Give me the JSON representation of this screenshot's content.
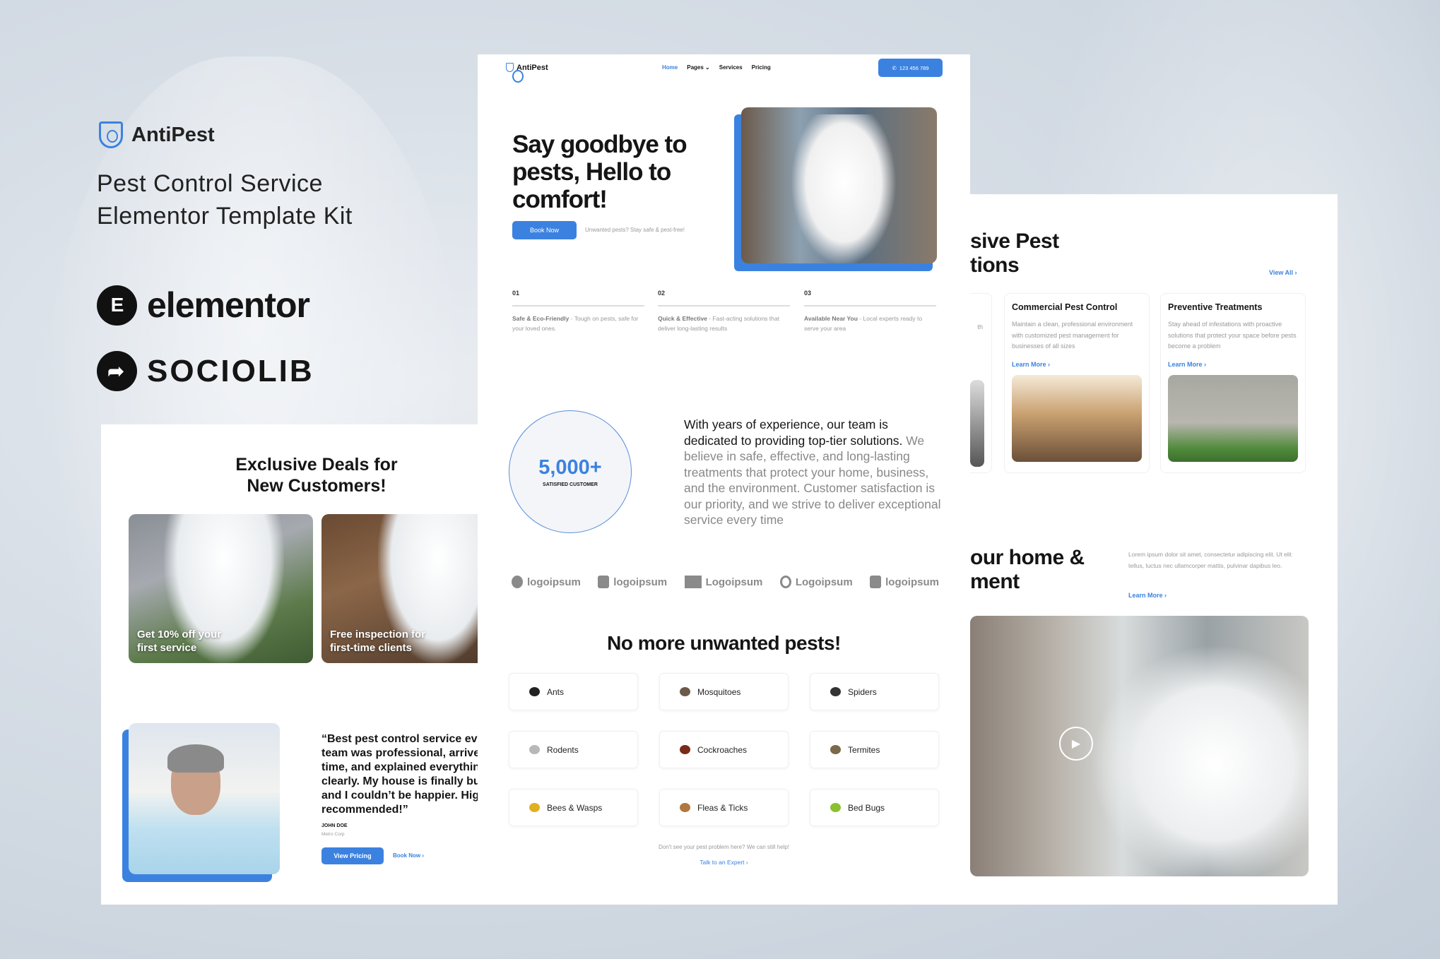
{
  "brand": {
    "name": "AntiPest",
    "title_line1": "Pest Control Service",
    "title_line2": "Elementor Template Kit",
    "partner1": "elementor",
    "partner2": "SOCIOLIB",
    "partner1_icon": "elementor-logo-icon",
    "partner2_icon": "share-arrow-icon"
  },
  "colors": {
    "accent": "#3b82e0",
    "text": "#151515",
    "muted": "#999999"
  },
  "site": {
    "logo": "AntiPest",
    "nav": [
      {
        "label": "Home",
        "active": true
      },
      {
        "label": "Pages",
        "dropdown": true
      },
      {
        "label": "Services"
      },
      {
        "label": "Pricing"
      }
    ],
    "phone": "123 456 789",
    "hero": {
      "line1": "Say goodbye to",
      "line2": "pests, Hello to",
      "line3": "comfort!",
      "cta": "Book Now",
      "sub": "Unwanted pests? Stay safe & pest-free!"
    },
    "features": [
      {
        "num": "01",
        "title": "Safe & Eco-Friendly",
        "desc": " - Tough on pests, safe for your loved ones."
      },
      {
        "num": "02",
        "title": "Quick & Effective",
        "desc": " - Fast-acting solutions that deliver long-lasting results"
      },
      {
        "num": "03",
        "title": "Available Near You",
        "desc": " - Local experts ready to serve your area"
      }
    ],
    "stat": {
      "value": "5,000+",
      "label": "SATISFIED CUSTOMER"
    },
    "about": {
      "lead": "With years of experience, our team is dedicated to providing top-tier solutions.",
      "body": " We believe in safe, effective, and long-lasting treatments that protect your home, business, and the environment. Customer satisfaction is our priority, and we strive to deliver exceptional service every time"
    },
    "logos": [
      "logoipsum",
      "logoipsum",
      "Logoipsum",
      "Logoipsum",
      "logoipsum"
    ],
    "pests_title": "No more unwanted pests!",
    "pests": [
      {
        "label": "Ants",
        "icon": "ant-icon",
        "color": "#222"
      },
      {
        "label": "Mosquitoes",
        "icon": "mosquito-icon",
        "color": "#6b5a4a"
      },
      {
        "label": "Spiders",
        "icon": "spider-icon",
        "color": "#333"
      },
      {
        "label": "Rodents",
        "icon": "mouse-icon",
        "color": "#b8b8b8"
      },
      {
        "label": "Cockroaches",
        "icon": "cockroach-icon",
        "color": "#7a2a1a"
      },
      {
        "label": "Termites",
        "icon": "termite-icon",
        "color": "#7a6a4a"
      },
      {
        "label": "Bees & Wasps",
        "icon": "bee-icon",
        "color": "#e0b020"
      },
      {
        "label": "Fleas & Ticks",
        "icon": "fly-icon",
        "color": "#b07840"
      },
      {
        "label": "Bed Bugs",
        "icon": "bug-icon",
        "color": "#8ac030"
      }
    ],
    "pests_note": "Don't see your pest problem here? We can still help!",
    "pests_link": "Talk to an Expert"
  },
  "deals": {
    "title_line1": "Exclusive Deals for",
    "title_line2": "New Customers!",
    "items": [
      "Get 10% off your first service",
      "Free inspection for first-time clients"
    ]
  },
  "testimonial": {
    "quote_lines": [
      "“Best pest control service ever!",
      "team was professional, arrived o",
      "time, and explained everything",
      "clearly. My house is finally bug-f",
      "and I couldn’t be happier. Highly",
      "recommended!”"
    ],
    "name": "JOHN DOE",
    "company": "Metro Corp",
    "primary": "View Pricing",
    "secondary": "Book Now"
  },
  "services": {
    "heading_line1": "sive Pest",
    "heading_line2": "tions",
    "view_all": "View All",
    "partial_card_text": "th",
    "cards": [
      {
        "title": "Commercial Pest Control",
        "desc": "Maintain a clean, professional environment with customized pest management for businesses of all sizes",
        "link": "Learn More"
      },
      {
        "title": "Preventive Treatments",
        "desc": "Stay ahead of infestations with proactive solutions that protect your space before pests become a problem",
        "link": "Learn More"
      }
    ]
  },
  "protect": {
    "heading_line1": "our home &",
    "heading_line2": "ment",
    "desc": "Lorem ipsum dolor sit amet, consectetur adipiscing elit. Ut elit tellus, luctus nec ullamcorper mattis, pulvinar dapibus leo.",
    "link": "Learn More"
  }
}
